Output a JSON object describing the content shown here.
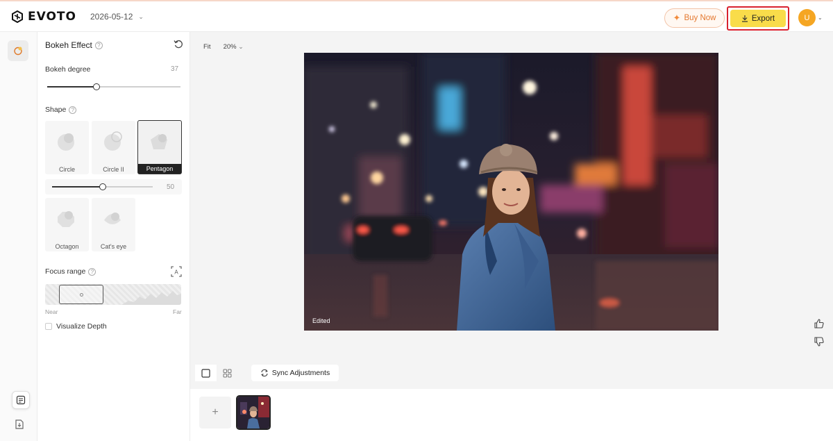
{
  "app": {
    "name": "EVOTO",
    "date": "2026-05-12"
  },
  "header": {
    "buy_label": "Buy Now",
    "export_label": "Export",
    "avatar_initial": "U",
    "colors": {
      "buy": "#e4782f",
      "export_bg": "#f9dc4a",
      "export_outline": "#d8212e",
      "avatar": "#f5a623"
    }
  },
  "panel": {
    "title": "Bokeh Effect",
    "bokeh_degree": {
      "label": "Bokeh degree",
      "value": "37",
      "fraction": 0.37
    },
    "shape": {
      "label": "Shape",
      "options": [
        "Circle",
        "Circle II",
        "Pentagon",
        "Octagon",
        "Cat's eye"
      ],
      "selected": "Pentagon",
      "sub_value": "50",
      "sub_fraction": 0.5
    },
    "focus_range": {
      "label": "Focus range",
      "near": "Near",
      "far": "Far"
    },
    "visualize_depth": {
      "label": "Visualize Depth",
      "checked": false
    }
  },
  "canvas": {
    "fit_label": "Fit",
    "zoom_label": "20%",
    "status_label": "Edited"
  },
  "bottom": {
    "sync_label": "Sync Adjustments",
    "add_label": "+"
  },
  "icons": [
    "logo-icon",
    "bokeh-tool-icon",
    "notes-icon",
    "import-icon",
    "reset-icon",
    "help-icon",
    "auto-focus-icon",
    "thumbs-up-icon",
    "thumbs-down-icon",
    "compare-icon",
    "single-view-icon",
    "grid-view-icon",
    "sync-icon",
    "download-icon",
    "sparkle-icon"
  ]
}
